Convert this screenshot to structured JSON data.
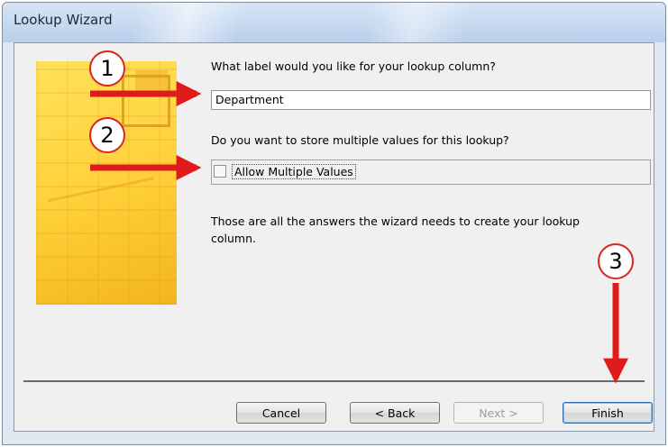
{
  "window": {
    "title": "Lookup Wizard"
  },
  "prompts": {
    "label_question": "What label would you like for your lookup column?",
    "multi_question": "Do you want to store multiple values for this lookup?",
    "info_text_line1": "Those are all the answers the wizard needs to create your lookup",
    "info_text_line2": "column."
  },
  "fields": {
    "label_value": "Department",
    "allow_multiple_label": "Allow Multiple Values",
    "allow_multiple_checked": false
  },
  "buttons": {
    "cancel": "Cancel",
    "back": "< Back",
    "next": "Next >",
    "finish": "Finish"
  },
  "annotations": {
    "callout_1": "1",
    "callout_2": "2",
    "callout_3": "3",
    "arrow_color": "#e01b1b"
  }
}
